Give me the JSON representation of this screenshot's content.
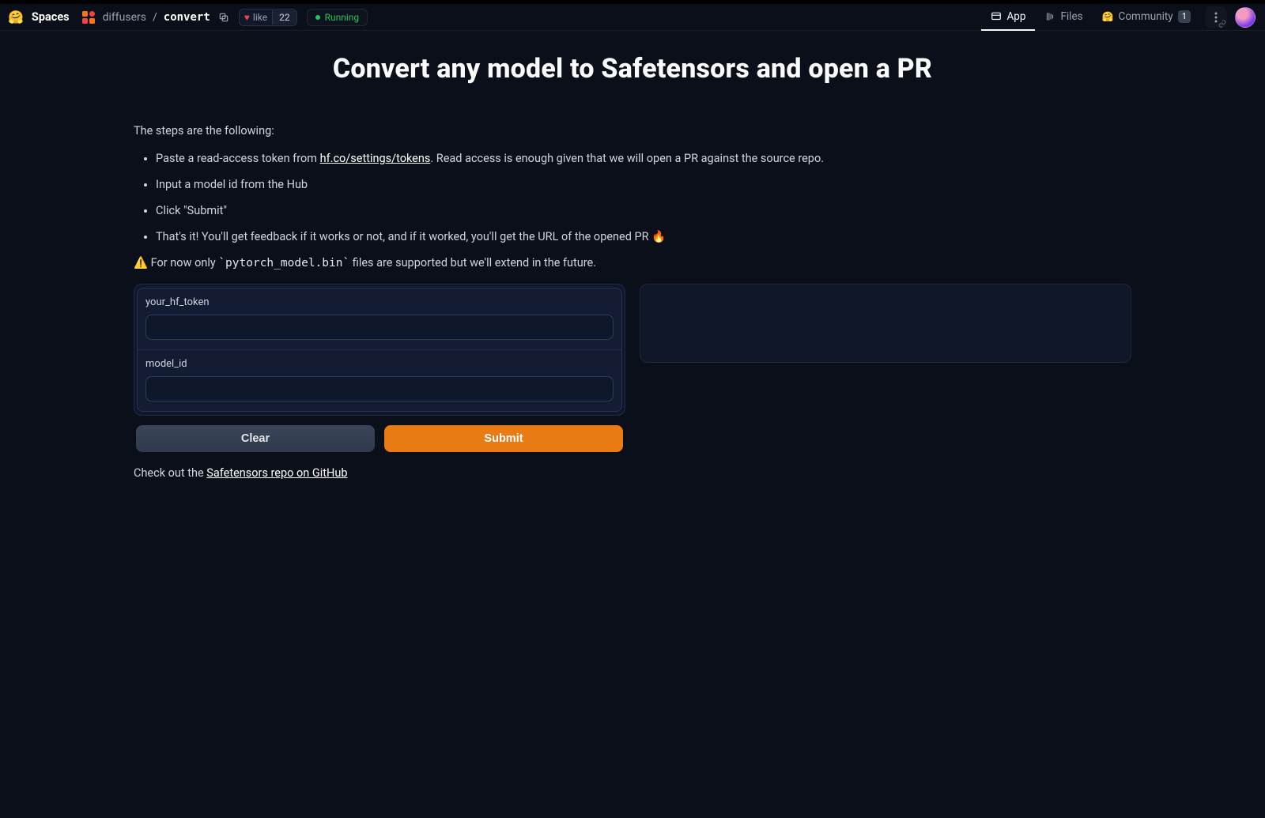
{
  "header": {
    "spaces_label": "Spaces",
    "owner": "diffusers",
    "repo": "convert",
    "like_text": "like",
    "like_count": "22",
    "status": "Running",
    "tabs": {
      "app": "App",
      "files": "Files",
      "community": "Community",
      "community_count": "1"
    }
  },
  "page": {
    "title": "Convert any model to Safetensors and open a PR",
    "intro": "The steps are the following:",
    "step1_a": "Paste a read-access token from ",
    "step1_link": "hf.co/settings/tokens",
    "step1_b": ". Read access is enough given that we will open a PR against the source repo.",
    "step2": "Input a model id from the Hub",
    "step3": "Click \"Submit\"",
    "step4": "That's it! You'll get feedback if it works or not, and if it worked, you'll get the URL of the opened PR 🔥",
    "note_a": "⚠️ For now only ",
    "note_code": "`pytorch_model.bin`",
    "note_b": " files are supported but we'll extend in the future.",
    "footer_a": "Check out the ",
    "footer_link": "Safetensors repo on GitHub"
  },
  "form": {
    "token_label": "your_hf_token",
    "model_label": "model_id",
    "clear": "Clear",
    "submit": "Submit"
  }
}
